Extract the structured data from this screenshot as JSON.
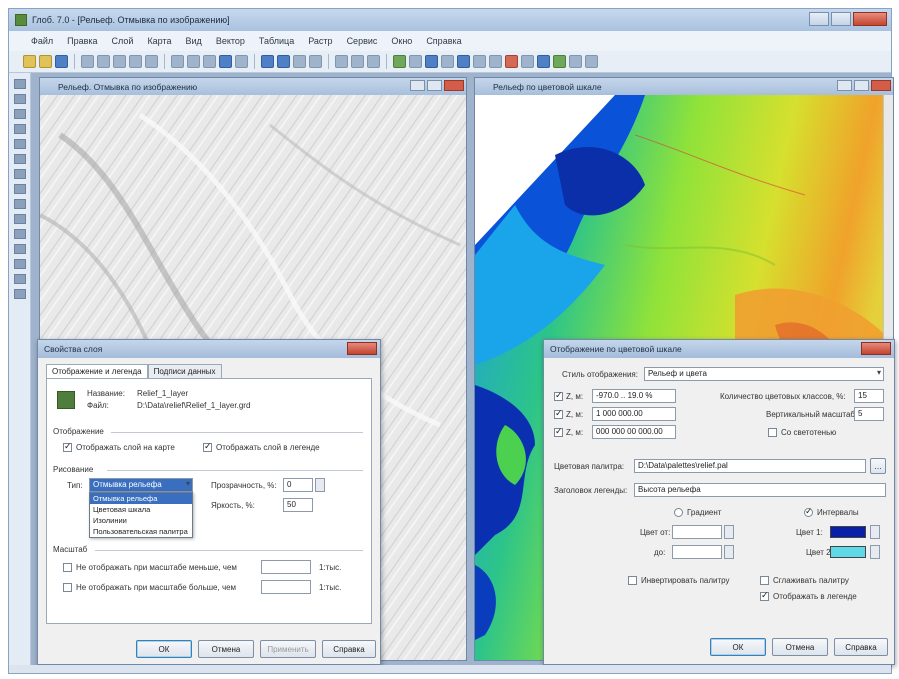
{
  "app": {
    "title": "Глоб. 7.0 - [Рельеф. Отмывка по изображению]",
    "menu": [
      "Файл",
      "Правка",
      "Слой",
      "Карта",
      "Вид",
      "Вектор",
      "Таблица",
      "Растр",
      "Сервис",
      "Окно",
      "Справка"
    ]
  },
  "windows": {
    "left_title": "Рельеф. Отмывка по изображению",
    "right_title": "Рельеф по цветовой шкале"
  },
  "layer_dialog": {
    "title": "Свойства слоя",
    "tabs": [
      "Отображение и легенда",
      "Подписи данных"
    ],
    "name_label": "Название:",
    "name_value": "Relief_1_layer",
    "file_label": "Файл:",
    "file_value": "D:\\Data\\relief\\Relief_1_layer.grd",
    "display_group": "Отображение",
    "check_show_layer": "Отображать слой на карте",
    "check_show_legend": "Отображать слой в легенде",
    "drawing_group": "Рисование",
    "draw_type_label": "Тип:",
    "draw_type_value": "Отмывка рельефа",
    "transparency_label": "Прозрачность, %:",
    "transparency_value": "0",
    "brightness_label": "Яркость, %:",
    "brightness_value": "50",
    "dropdown_options": [
      "Отмывка рельефа",
      "Цветовая шкала",
      "Изолинии",
      "Пользовательская палитра"
    ],
    "scale_group": "Масштаб",
    "check_min_scale": "Не отображать при масштабе меньше, чем",
    "check_max_scale": "Не отображать при масштабе больше, чем",
    "scale_unit": "1:тыс.",
    "buttons": [
      "ОК",
      "Отмена",
      "Применить",
      "Справка"
    ]
  },
  "color_dialog": {
    "title": "Отображение по цветовой шкале",
    "style_label": "Стиль отображения:",
    "style_value": "Рельеф и цвета",
    "row_z1": "Z, м:",
    "row_z1_value": "-970.0 .. 19.0 %",
    "row_z2": "Z, м:",
    "row_z2_value": "1 000 000.00",
    "row_z3": "Z, м:",
    "row_z3_value": "000 000 00 000.00",
    "precision_label": "Количество цветовых классов, %:",
    "precision_value": "15",
    "shading_label": "Вертикальный масштаб:",
    "shading_value": "5",
    "check_shading": "Со светотенью",
    "palette_label": "Цветовая палитра:",
    "palette_value": "D:\\Data\\palettes\\relief.pal",
    "legend_label": "Заголовок легенды:",
    "legend_value": "Высота рельефа",
    "radio_gradient": "Градиент",
    "radio_classes": "Интервалы",
    "from_label": "Цвет от:",
    "to_label": "до:",
    "color1_label": "Цвет 1:",
    "color2_label": "Цвет 2:",
    "color1": "#0a1fa8",
    "color2": "#5fd8e8",
    "check_invert": "Инвертировать палитру",
    "check_smooth": "Сглаживать палитру",
    "check_show_legend": "Отображать в легенде",
    "buttons": [
      "ОК",
      "Отмена",
      "Справка"
    ]
  }
}
